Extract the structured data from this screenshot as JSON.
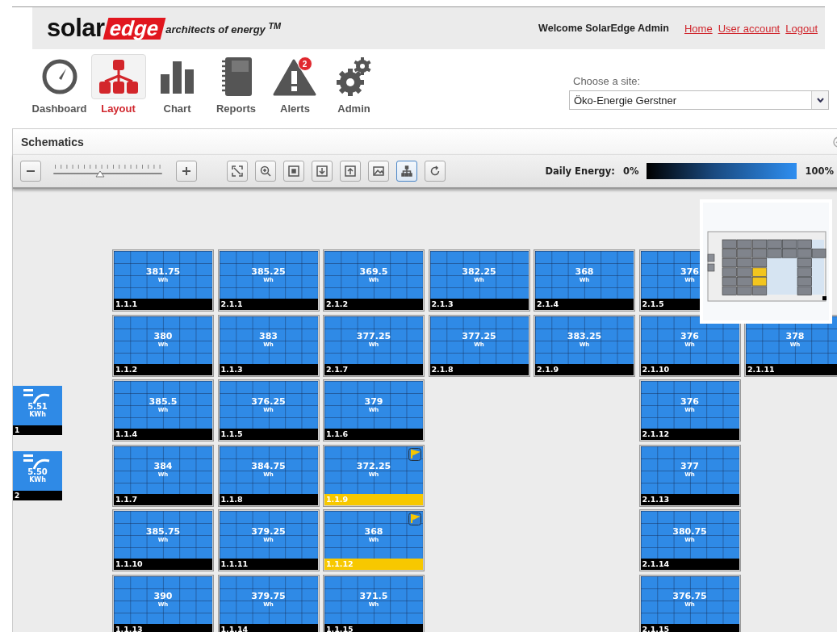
{
  "header": {
    "logo": {
      "word": "solar",
      "badge": "edge",
      "tagline": "architects of energy $^{TM}$"
    },
    "welcome": "Welcome SolarEdge Admin",
    "links": [
      "Home",
      "User account",
      "Logout"
    ]
  },
  "nav": [
    {
      "label": "Dashboard",
      "selected": false
    },
    {
      "label": "Layout",
      "selected": true
    },
    {
      "label": "Chart",
      "selected": false
    },
    {
      "label": "Reports",
      "selected": false
    },
    {
      "label": "Alerts",
      "selected": false,
      "badge": "2"
    },
    {
      "label": "Admin",
      "selected": false
    }
  ],
  "site_chooser": {
    "label": "Choose a site:",
    "value": "Öko-Energie Gerstner"
  },
  "schematics": {
    "title": "Schematics",
    "zoom_slider": {
      "level": 0.43
    },
    "tools": [
      {
        "selected": false
      },
      {
        "selected": false
      },
      {
        "selected": false
      },
      {
        "selected": false
      },
      {
        "selected": false
      },
      {
        "selected": false
      },
      {
        "selected": true
      },
      {
        "selected": false
      }
    ],
    "daily_energy": {
      "label": "Daily Energy:",
      "min": "0%",
      "max": "100%"
    },
    "inverters": [
      {
        "value": "5.51",
        "unit": "KWh",
        "label": "1"
      },
      {
        "value": "5.50",
        "unit": "KWh",
        "label": "2"
      }
    ],
    "rows": [
      [
        {
          "kind": "panel",
          "label": "1.1.1",
          "value": "381.75",
          "unit": "Wh",
          "alert": false
        },
        {
          "kind": "panel",
          "label": "2.1.1",
          "value": "385.25",
          "unit": "Wh",
          "alert": false
        },
        {
          "kind": "panel",
          "label": "2.1.2",
          "value": "369.5",
          "unit": "Wh",
          "alert": false
        },
        {
          "kind": "panel",
          "label": "2.1.3",
          "value": "382.25",
          "unit": "Wh",
          "alert": false
        },
        {
          "kind": "panel",
          "label": "2.1.4",
          "value": "368",
          "unit": "Wh",
          "alert": false
        },
        {
          "kind": "panel",
          "label": "2.1.5",
          "value": "376",
          "unit": "Wh",
          "alert": false
        },
        {
          "kind": "empty"
        }
      ],
      [
        {
          "kind": "panel",
          "label": "1.1.2",
          "value": "380",
          "unit": "Wh",
          "alert": false
        },
        {
          "kind": "panel",
          "label": "1.1.3",
          "value": "383",
          "unit": "Wh",
          "alert": false
        },
        {
          "kind": "panel",
          "label": "2.1.7",
          "value": "377.25",
          "unit": "Wh",
          "alert": false
        },
        {
          "kind": "panel",
          "label": "2.1.8",
          "value": "377.25",
          "unit": "Wh",
          "alert": false
        },
        {
          "kind": "panel",
          "label": "2.1.9",
          "value": "383.25",
          "unit": "Wh",
          "alert": false
        },
        {
          "kind": "panel",
          "label": "2.1.10",
          "value": "376",
          "unit": "Wh",
          "alert": false
        },
        {
          "kind": "panel",
          "label": "2.1.11",
          "value": "378",
          "unit": "Wh",
          "alert": false
        }
      ],
      [
        {
          "kind": "panel",
          "label": "1.1.4",
          "value": "385.5",
          "unit": "Wh",
          "alert": false
        },
        {
          "kind": "panel",
          "label": "1.1.5",
          "value": "376.25",
          "unit": "Wh",
          "alert": false
        },
        {
          "kind": "panel",
          "label": "1.1.6",
          "value": "379",
          "unit": "Wh",
          "alert": false
        },
        {
          "kind": "empty"
        },
        {
          "kind": "empty"
        },
        {
          "kind": "panel",
          "label": "2.1.12",
          "value": "376",
          "unit": "Wh",
          "alert": false
        },
        {
          "kind": "empty"
        }
      ],
      [
        {
          "kind": "panel",
          "label": "1.1.7",
          "value": "384",
          "unit": "Wh",
          "alert": false
        },
        {
          "kind": "panel",
          "label": "1.1.8",
          "value": "384.75",
          "unit": "Wh",
          "alert": false
        },
        {
          "kind": "panel",
          "label": "1.1.9",
          "value": "372.25",
          "unit": "Wh",
          "alert": true
        },
        {
          "kind": "empty"
        },
        {
          "kind": "empty"
        },
        {
          "kind": "panel",
          "label": "2.1.13",
          "value": "377",
          "unit": "Wh",
          "alert": false
        },
        {
          "kind": "empty"
        }
      ],
      [
        {
          "kind": "panel",
          "label": "1.1.10",
          "value": "385.75",
          "unit": "Wh",
          "alert": false
        },
        {
          "kind": "panel",
          "label": "1.1.11",
          "value": "379.25",
          "unit": "Wh",
          "alert": false
        },
        {
          "kind": "panel",
          "label": "1.1.12",
          "value": "368",
          "unit": "Wh",
          "alert": true
        },
        {
          "kind": "empty"
        },
        {
          "kind": "empty"
        },
        {
          "kind": "panel",
          "label": "2.1.14",
          "value": "380.75",
          "unit": "Wh",
          "alert": false
        },
        {
          "kind": "empty"
        }
      ],
      [
        {
          "kind": "panel",
          "label": "1.1.13",
          "value": "390",
          "unit": "Wh",
          "alert": false
        },
        {
          "kind": "panel",
          "label": "1.1.14",
          "value": "379.75",
          "unit": "Wh",
          "alert": false
        },
        {
          "kind": "panel",
          "label": "1.1.15",
          "value": "371.5",
          "unit": "Wh",
          "alert": false
        },
        {
          "kind": "empty"
        },
        {
          "kind": "empty"
        },
        {
          "kind": "panel",
          "label": "2.1.15",
          "value": "376.75",
          "unit": "Wh",
          "alert": false
        },
        {
          "kind": "empty"
        }
      ]
    ]
  }
}
